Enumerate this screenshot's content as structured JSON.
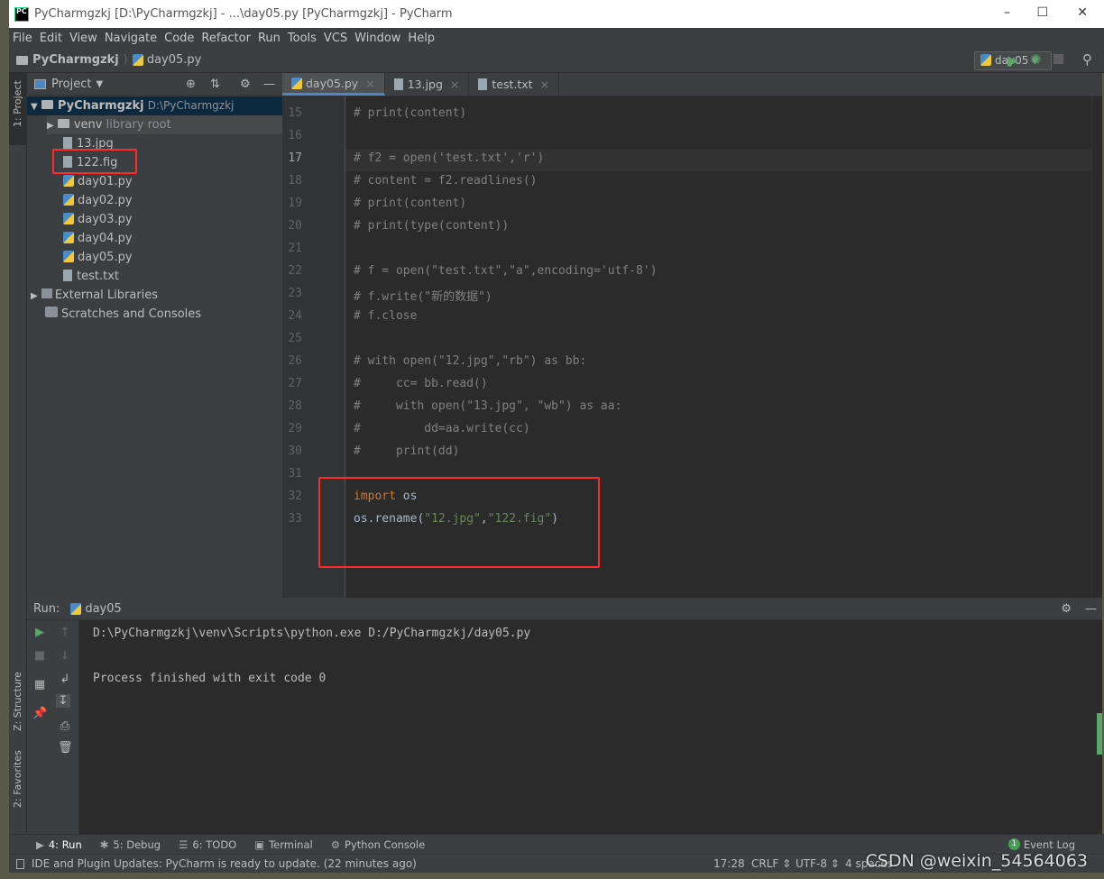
{
  "window": {
    "title": "PyCharmgzkj [D:\\PyCharmgzkj] - ...\\day05.py [PyCharmgzkj] - PyCharm",
    "logo": "PC"
  },
  "menu": [
    "File",
    "Edit",
    "View",
    "Navigate",
    "Code",
    "Refactor",
    "Run",
    "Tools",
    "VCS",
    "Window",
    "Help"
  ],
  "breadcrumb": {
    "project": "PyCharmgzkj",
    "file": "day05.py"
  },
  "run_config": "day05",
  "left_strip": {
    "project": "1: Project",
    "structure": "Z: Structure",
    "favorites": "2: Favorites"
  },
  "project_panel": {
    "title": "Project",
    "root": {
      "name": "PyCharmgzkj",
      "path": "D:\\PyCharmgzkj"
    },
    "venv": {
      "name": "venv",
      "note": "library root"
    },
    "files": [
      "13.jpg",
      "122.fig",
      "day01.py",
      "day02.py",
      "day03.py",
      "day04.py",
      "day05.py",
      "test.txt"
    ],
    "external": "External Libraries",
    "scratches": "Scratches and Consoles"
  },
  "tabs": [
    "day05.py",
    "13.jpg",
    "test.txt"
  ],
  "code": {
    "lines": [
      {
        "n": "15",
        "segs": [
          {
            "t": "comment",
            "s": "# print(content)"
          }
        ]
      },
      {
        "n": "16",
        "segs": []
      },
      {
        "n": "17",
        "segs": [
          {
            "t": "comment",
            "s": "# f2 = open('test.txt','r')"
          }
        ]
      },
      {
        "n": "18",
        "segs": [
          {
            "t": "comment",
            "s": "# content = f2.readlines()"
          }
        ]
      },
      {
        "n": "19",
        "segs": [
          {
            "t": "comment",
            "s": "# print(content)"
          }
        ]
      },
      {
        "n": "20",
        "segs": [
          {
            "t": "comment",
            "s": "# print(type(content))"
          }
        ]
      },
      {
        "n": "21",
        "segs": []
      },
      {
        "n": "22",
        "segs": [
          {
            "t": "comment",
            "s": "# f = open(\"test.txt\",\"a\",encoding='utf-8')"
          }
        ]
      },
      {
        "n": "23",
        "segs": [
          {
            "t": "comment",
            "s": "# f.write(\"新的数据\")"
          }
        ]
      },
      {
        "n": "24",
        "segs": [
          {
            "t": "comment",
            "s": "# f.close"
          }
        ]
      },
      {
        "n": "25",
        "segs": []
      },
      {
        "n": "26",
        "segs": [
          {
            "t": "comment",
            "s": "# with open(\"12.jpg\",\"rb\") as bb:"
          }
        ]
      },
      {
        "n": "27",
        "segs": [
          {
            "t": "comment",
            "s": "#     cc= bb.read()"
          }
        ]
      },
      {
        "n": "28",
        "segs": [
          {
            "t": "comment",
            "s": "#     with open(\"13.jpg\", \"wb\") as aa:"
          }
        ]
      },
      {
        "n": "29",
        "segs": [
          {
            "t": "comment",
            "s": "#         dd=aa.write(cc)"
          }
        ]
      },
      {
        "n": "30",
        "segs": [
          {
            "t": "comment",
            "s": "#     print(dd)"
          }
        ]
      },
      {
        "n": "31",
        "segs": []
      },
      {
        "n": "32",
        "segs": [
          {
            "t": "keyword",
            "s": "import"
          },
          {
            "t": "plain",
            "s": " os"
          }
        ]
      },
      {
        "n": "33",
        "segs": [
          {
            "t": "plain",
            "s": "os.rename("
          },
          {
            "t": "string",
            "s": "\"12.jpg\""
          },
          {
            "t": "plain",
            "s": ","
          },
          {
            "t": "string",
            "s": "\"122.fig\""
          },
          {
            "t": "plain",
            "s": ")"
          }
        ]
      }
    ]
  },
  "run_panel": {
    "label": "Run:",
    "config": "day05",
    "output": [
      "D:\\PyCharmgzkj\\venv\\Scripts\\python.exe D:/PyCharmgzkj/day05.py",
      "",
      "Process finished with exit code 0"
    ]
  },
  "tool_windows": [
    "4: Run",
    "5: Debug",
    "6: TODO",
    "Terminal",
    "Python Console"
  ],
  "event_log": {
    "label": "Event Log",
    "count": "1"
  },
  "status": {
    "message": "IDE and Plugin Updates: PyCharm is ready to update. (22 minutes ago)",
    "position": "17:28",
    "line_sep": "CRLF",
    "encoding": "UTF-8",
    "indent": "4 spaces"
  },
  "watermark": "CSDN @weixin_54564063",
  "colors": {
    "highlight_box": "#ff2a2a",
    "accent": "#4a88c7"
  }
}
